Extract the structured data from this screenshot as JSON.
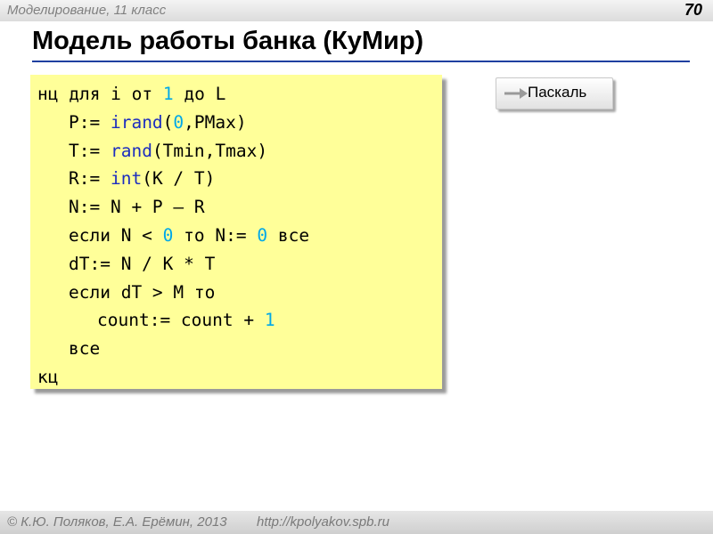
{
  "header": {
    "course": "Моделирование, 11 класс",
    "page_number": "70"
  },
  "slide": {
    "title": "Модель работы банка (КуМир)"
  },
  "code": {
    "l1": {
      "a": "нц для i от ",
      "b": "1",
      "c": " до L"
    },
    "l2": {
      "a": "P:= ",
      "fn": "irand",
      "b": "(",
      "n1": "0",
      "c": ",PMax)"
    },
    "l3": {
      "a": "T:= ",
      "fn": "rand",
      "b": "(Tmin,Tmax)"
    },
    "l4": {
      "a": "R:= ",
      "fn": "int",
      "b": "(K / T)"
    },
    "l5": {
      "a": "N:= N + P – R"
    },
    "l6": {
      "a": "если N < ",
      "n1": "0",
      "b": " то N:= ",
      "n2": "0",
      "c": " все"
    },
    "l7": {
      "a": "dT:= N / K * T"
    },
    "l8": {
      "a": "если dT > M то"
    },
    "l9": {
      "a": "count:= count + ",
      "n1": "1"
    },
    "l10": {
      "a": "все"
    },
    "l11": {
      "a": "кц"
    }
  },
  "nav": {
    "pascal_label": "Паскаль",
    "icon": "arrow-right-icon",
    "arrow_color": "#9a9a9a"
  },
  "footer": {
    "copyright": "© К.Ю. Поляков, Е.А. Ерёмин, 2013",
    "url": "http://kpolyakov.spb.ru"
  },
  "colors": {
    "code_background": "#ffff99",
    "function_color": "#1c2dbf",
    "number_color": "#00a8e8",
    "title_rule": "#1f3fa0"
  }
}
